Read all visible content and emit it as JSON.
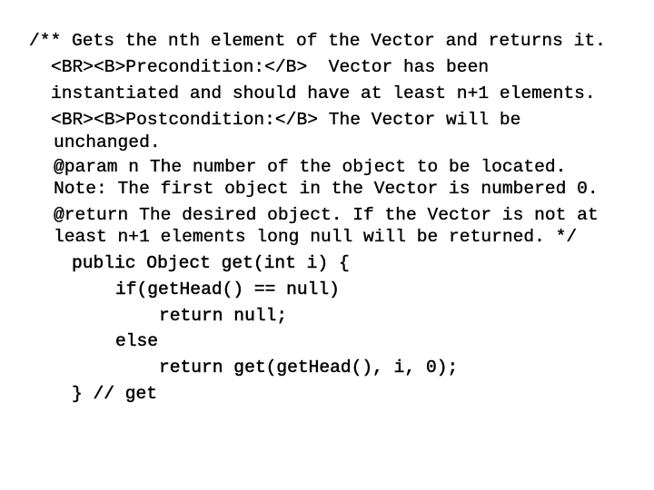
{
  "javadoc": [
    "/** Gets the nth element of the Vector and returns it.",
    "<BR><B>Precondition:</B>  Vector has been",
    "instantiated and should have at least n+1 elements.",
    "<BR><B>Postcondition:</B> The Vector will be",
    "unchanged.",
    "@param n The number of the object to be located.",
    "Note: The first object in the Vector is numbered 0.",
    "@return The desired object. If the Vector is not at",
    "least n+1 elements long null will be returned. */"
  ],
  "code": [
    "public Object get(int i) {",
    "if(getHead() == null)",
    "return null;",
    "else",
    "return get(getHead(), i, 0);",
    "} // get"
  ]
}
